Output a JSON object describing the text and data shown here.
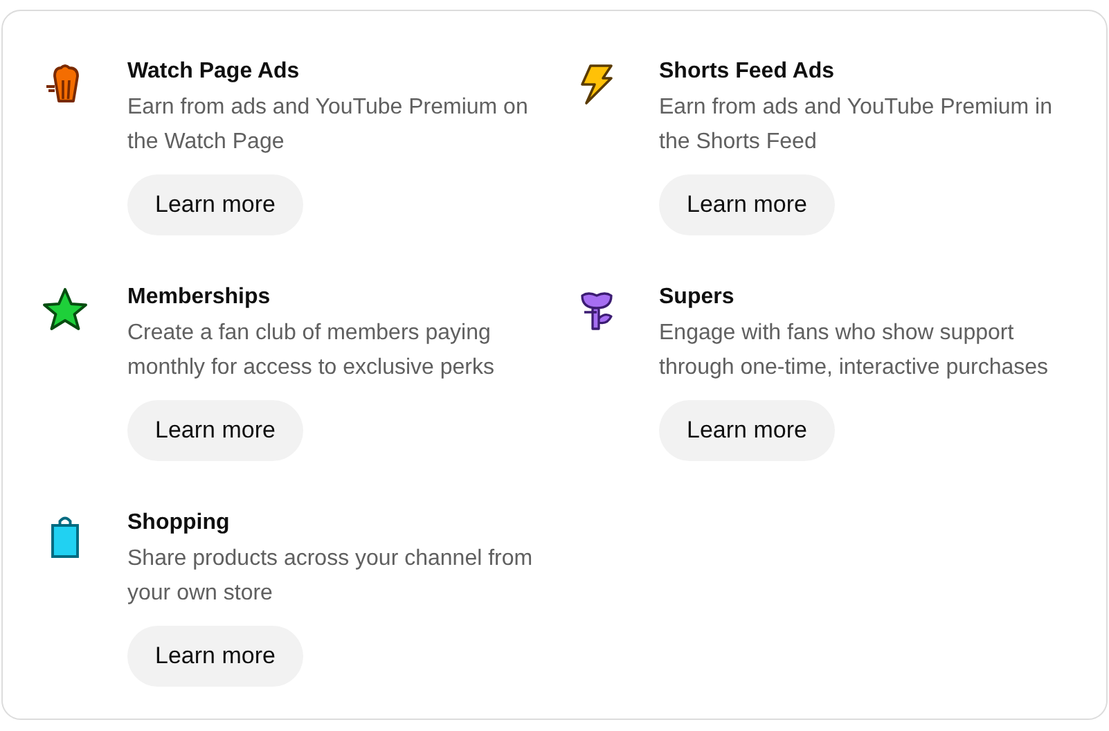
{
  "features": [
    {
      "kind": "popcorn",
      "title": "Watch Page Ads",
      "description": "Earn from ads and YouTube Premium on the Watch Page",
      "button": "Learn more"
    },
    {
      "kind": "bolt",
      "title": "Shorts Feed Ads",
      "description": "Earn from ads and YouTube Premium in the Shorts Feed",
      "button": "Learn more"
    },
    {
      "kind": "star",
      "title": "Memberships",
      "description": "Create a fan club of members paying monthly for access to exclusive perks",
      "button": "Learn more"
    },
    {
      "kind": "flower",
      "title": "Supers",
      "description": "Engage with fans who show support through one-time, interactive purchases",
      "button": "Learn more"
    },
    {
      "kind": "bag",
      "title": "Shopping",
      "description": "Share products across your channel from your own store",
      "button": "Learn more"
    }
  ]
}
